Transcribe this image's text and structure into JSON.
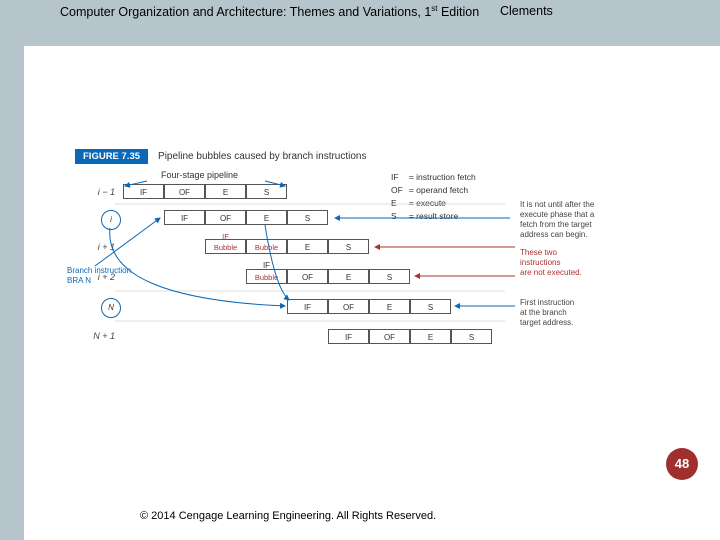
{
  "header": {
    "title_prefix": "Computer Organization and Architecture: Themes and Variations, 1",
    "title_sup": "st",
    "title_suffix": " Edition",
    "author": "Clements"
  },
  "figure": {
    "tag": "FIGURE 7.35",
    "caption": "Pipeline bubbles caused by branch instructions",
    "four_stage_label": "Four-stage pipeline",
    "legend": {
      "IF": "= instruction fetch",
      "OF": "= operand fetch",
      "E": "= execute",
      "S": "= result store"
    },
    "row_labels": [
      "i − 1",
      "i",
      "i + 1",
      "i + 2",
      "N",
      "N + 1"
    ],
    "stages": [
      "IF",
      "OF",
      "E",
      "S"
    ],
    "bubble_label": "Bubble",
    "branch_label_l1": "Branch instruction",
    "branch_label_l2": "BRA  N",
    "note_exec_l1": "It is not until after the",
    "note_exec_l2": "execute phase that a",
    "note_exec_l3": "fetch from the target",
    "note_exec_l4": "address can begin.",
    "note_two_l1": "These two",
    "note_two_l2": "instructions",
    "note_two_l3": "are not executed.",
    "note_first_l1": "First instruction",
    "note_first_l2": "at the branch",
    "note_first_l3": "target address.",
    "circle_i": "i",
    "circle_N": "N"
  },
  "page_number": "48",
  "footer": "© 2014 Cengage Learning Engineering. All Rights Reserved."
}
